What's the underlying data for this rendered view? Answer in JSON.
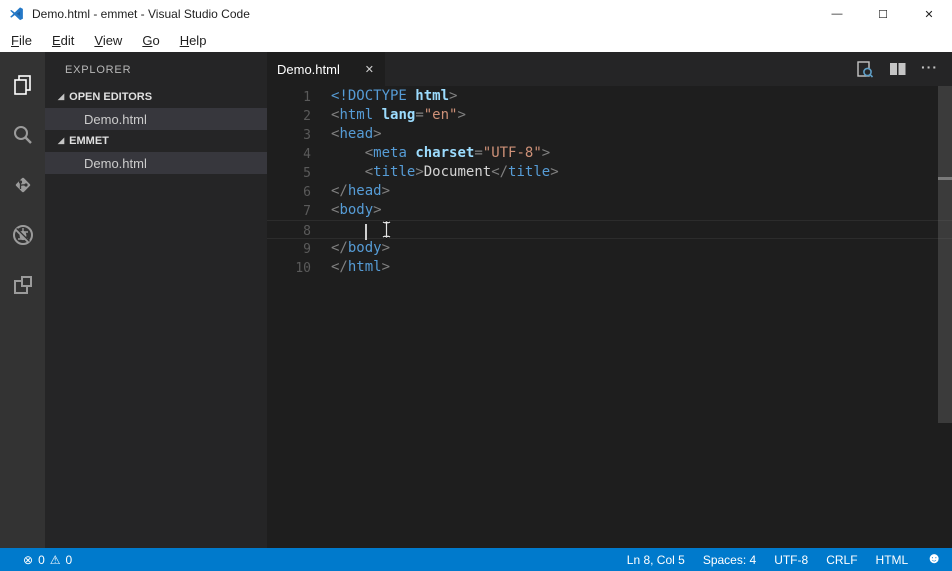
{
  "window": {
    "title": "Demo.html - emmet - Visual Studio Code",
    "controls": {
      "minimize": "—",
      "maximize": "☐",
      "close": "✕"
    }
  },
  "menu": {
    "items": [
      "File",
      "Edit",
      "View",
      "Go",
      "Help"
    ]
  },
  "activity_bar": {
    "items": [
      "explorer-icon",
      "search-icon",
      "source-control-icon",
      "debug-icon",
      "extensions-icon"
    ]
  },
  "sidebar": {
    "title": "EXPLORER",
    "twisty": "◢",
    "sections": [
      {
        "label": "OPEN EDITORS",
        "items": [
          {
            "label": "Demo.html",
            "selected": true
          }
        ]
      },
      {
        "label": "EMMET",
        "items": [
          {
            "label": "Demo.html",
            "selected": true
          }
        ]
      }
    ]
  },
  "editor": {
    "tab": {
      "label": "Demo.html",
      "close_glyph": "✕"
    },
    "actions": {
      "more_glyph": "···"
    },
    "cursor": {
      "line": 8,
      "col": 5
    },
    "lines": [
      {
        "n": "1",
        "tokens": [
          [
            "<!DOCTYPE",
            "t"
          ],
          [
            " ",
            "x"
          ],
          [
            "html",
            "a"
          ],
          [
            ">",
            "p"
          ]
        ]
      },
      {
        "n": "2",
        "tokens": [
          [
            "<",
            "p"
          ],
          [
            "html",
            "t"
          ],
          [
            " ",
            "x"
          ],
          [
            "lang",
            "a"
          ],
          [
            "=",
            "p"
          ],
          [
            "\"en\"",
            "s"
          ],
          [
            ">",
            "p"
          ]
        ]
      },
      {
        "n": "3",
        "tokens": [
          [
            "<",
            "p"
          ],
          [
            "head",
            "t"
          ],
          [
            ">",
            "p"
          ]
        ]
      },
      {
        "n": "4",
        "tokens": [
          [
            "    ",
            "x"
          ],
          [
            "<",
            "p"
          ],
          [
            "meta",
            "t"
          ],
          [
            " ",
            "x"
          ],
          [
            "charset",
            "a"
          ],
          [
            "=",
            "p"
          ],
          [
            "\"UTF-8\"",
            "s"
          ],
          [
            ">",
            "p"
          ]
        ]
      },
      {
        "n": "5",
        "tokens": [
          [
            "    ",
            "x"
          ],
          [
            "<",
            "p"
          ],
          [
            "title",
            "t"
          ],
          [
            ">",
            "p"
          ],
          [
            "Document",
            "x"
          ],
          [
            "</",
            "p"
          ],
          [
            "title",
            "t"
          ],
          [
            ">",
            "p"
          ]
        ]
      },
      {
        "n": "6",
        "tokens": [
          [
            "</",
            "p"
          ],
          [
            "head",
            "t"
          ],
          [
            ">",
            "p"
          ]
        ]
      },
      {
        "n": "7",
        "tokens": [
          [
            "<",
            "p"
          ],
          [
            "body",
            "t"
          ],
          [
            ">",
            "p"
          ]
        ]
      },
      {
        "n": "8",
        "tokens": [
          [
            "    ",
            "x"
          ]
        ],
        "current": true,
        "caret": true
      },
      {
        "n": "9",
        "tokens": [
          [
            "</",
            "p"
          ],
          [
            "body",
            "t"
          ],
          [
            ">",
            "p"
          ]
        ]
      },
      {
        "n": "10",
        "tokens": [
          [
            "</",
            "p"
          ],
          [
            "html",
            "t"
          ],
          [
            ">",
            "p"
          ]
        ]
      }
    ]
  },
  "status_bar": {
    "errors": "0",
    "warnings": "0",
    "error_glyph": "⊗",
    "warning_glyph": "⚠",
    "cursor_position": "Ln 8, Col 5",
    "indentation": "Spaces: 4",
    "encoding": "UTF-8",
    "eol": "CRLF",
    "language": "HTML",
    "smiley_glyph": "☻"
  },
  "colors": {
    "statusbar_bg": "#007acc",
    "editor_bg": "#1e1e1e",
    "sidebar_bg": "#252526",
    "activitybar_bg": "#333333",
    "selection_bg": "#37373d",
    "tag": "#569cd6",
    "attribute": "#9cdcfe",
    "string": "#ce9178",
    "punctuation": "#808080"
  }
}
